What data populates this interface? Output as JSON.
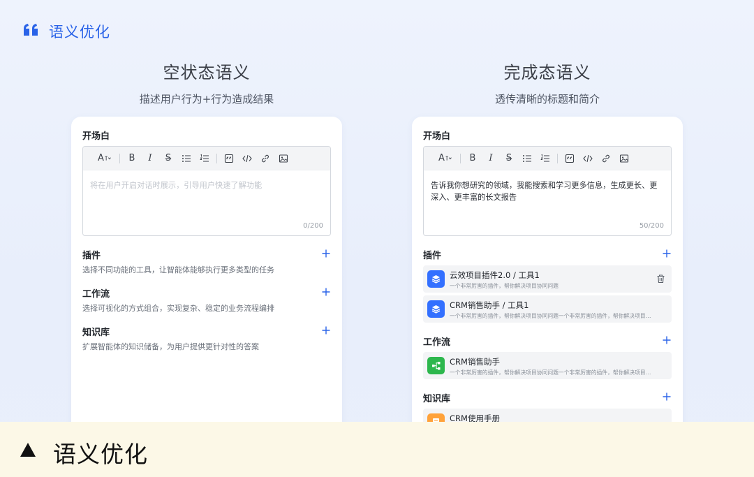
{
  "header": {
    "title": "语义优化",
    "icon": "quote-icon",
    "accent": "#2a63e8"
  },
  "columns": {
    "left": {
      "title": "空状态语义",
      "subtitle": "描述用户行为+行为造成结果"
    },
    "right": {
      "title": "完成态语义",
      "subtitle": "透传清晰的标题和简介"
    }
  },
  "toolbar_icons": [
    "font-size-icon",
    "bold-icon",
    "italic-icon",
    "strikethrough-icon",
    "bullet-list-icon",
    "numbered-list-icon",
    "quote-block-icon",
    "code-icon",
    "link-icon",
    "image-icon"
  ],
  "toolbar_labels": {
    "font": "A",
    "bold": "B",
    "italic": "I",
    "strike": "S"
  },
  "left_card": {
    "opening": {
      "label": "开场白",
      "placeholder": "将在用户开启对话时展示，引导用户快速了解功能",
      "counter": "0/200"
    },
    "plugins": {
      "label": "插件",
      "desc": "选择不同功能的工具，让智能体能够执行更多类型的任务"
    },
    "workflow": {
      "label": "工作流",
      "desc": "选择可视化的方式组合，实现复杂、稳定的业务流程编排"
    },
    "knowledge": {
      "label": "知识库",
      "desc": "扩展智能体的知识储备，为用户提供更针对性的答案"
    }
  },
  "right_card": {
    "opening": {
      "label": "开场白",
      "text": "告诉我你想研究的领域，我能搜索和学习更多信息，生成更长、更深入、更丰富的长文报告",
      "counter": "50/200"
    },
    "plugins": {
      "label": "插件",
      "items": [
        {
          "title": "云效项目插件2.0 / 工具1",
          "desc": "一个非常厉害的插件，帮你解决项目协同问题"
        },
        {
          "title": "CRM销售助手 / 工具1",
          "desc": "一个非常厉害的插件，帮你解决项目协同问题一个非常厉害的插件，帮你解决项目协同问题"
        }
      ]
    },
    "workflow": {
      "label": "工作流",
      "items": [
        {
          "title": "CRM销售助手",
          "desc": "一个非常厉害的插件，帮你解决项目协同问题一个非常厉害的插件，帮你解决项目协同问题"
        }
      ]
    },
    "knowledge": {
      "label": "知识库",
      "items": [
        {
          "title": "CRM使用手册"
        }
      ]
    }
  },
  "banner": {
    "text": "语义优化",
    "icon": "triangle-up-icon",
    "background": "#fcf8e7"
  },
  "colors": {
    "plus": "#2a63e8",
    "plugin_icon": "#3370ff",
    "workflow_icon": "#2db74d",
    "knowledge_icon": "#ffa23a"
  }
}
